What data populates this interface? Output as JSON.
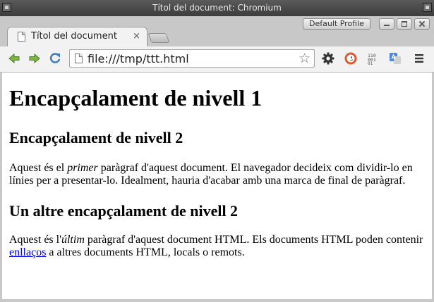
{
  "os_window": {
    "title": "Títol del document: Chromium"
  },
  "browser": {
    "profile_label": "Default Profile",
    "tab": {
      "title": "Títol del document",
      "close_glyph": "×"
    },
    "omnibox": {
      "url": "file:///tmp/ttt.html",
      "star_glyph": "☆"
    },
    "toolbar_icons": [
      "back-arrow-icon",
      "forward-arrow-icon",
      "reload-icon",
      "settings-gear-icon",
      "duckduckgo-icon",
      "binary-code-icon",
      "translate-icon",
      "hamburger-menu-icon"
    ],
    "accent_colors": {
      "nav_green": "#6aa84f",
      "reload_blue": "#3d7fc1",
      "duckduckgo": "#de5833",
      "translate": "#4a86e8"
    }
  },
  "page": {
    "h1": "Encapçalament de nivell 1",
    "h2_first": "Encapçalament de nivell 2",
    "p1": {
      "before": "Aquest és el ",
      "emph": "primer",
      "after": " paràgraf d'aquest document. El navegador decideix com dividir-lo en línies per a presentar-lo. Idealment, hauria d'acabar amb una marca de final de paràgraf."
    },
    "h2_second": "Un altre encapçalament de nivell 2",
    "p2": {
      "before": "Aquest és l'",
      "emph": "últim",
      "after": " paràgraf d'aquest document HTML. Els documents HTML poden contenir ",
      "link": "enllaços",
      "end": " a altres documents HTML, locals o remots."
    },
    "link_color": "#0000ee"
  }
}
